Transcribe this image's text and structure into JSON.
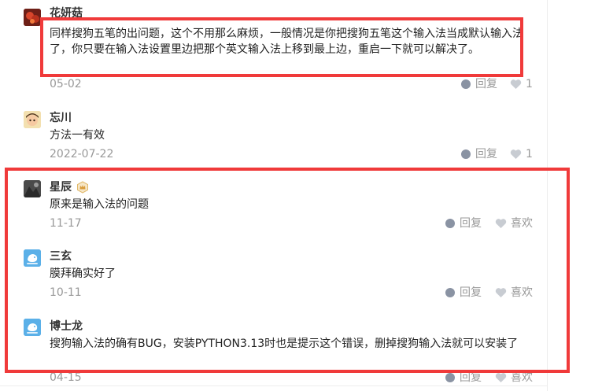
{
  "colors": {
    "highlight": "#f03a3a",
    "muted_text": "#999999",
    "icon_gray": "#8a93a3",
    "heart_gray": "#c8ccd2"
  },
  "comments": [
    {
      "username": "花妍菇",
      "content": "同样搜狗五笔的出问题，这个不用那么麻烦，一般情况是你把搜狗五笔这个输入法当成默认输入法了，你只要在输入法设置里边把那个英文输入法上移到最上边，重启一下就可以解决了。",
      "date": "05-02",
      "reply_label": "回复",
      "like_label": "1",
      "avatar_icon": "avatar-icon"
    },
    {
      "username": "忘川",
      "content": "方法一有效",
      "date": "2022-07-22",
      "reply_label": "回复",
      "like_label": "1",
      "avatar_icon": "avatar-icon"
    },
    {
      "username": "星辰",
      "content": "原来是输入法的问题",
      "date": "11-17",
      "reply_label": "回复",
      "like_label": "喜欢",
      "badge_icon": "crown-badge-icon",
      "avatar_icon": "avatar-icon"
    },
    {
      "username": "三玄",
      "content": "膜拜确实好了",
      "date": "10-11",
      "reply_label": "回复",
      "like_label": "喜欢",
      "avatar_icon": "default-avatar-icon"
    },
    {
      "username": "博士龙",
      "content": "搜狗输入法的确有BUG，安装PYTHON3.13时也是提示这个错误，删掉搜狗输入法就可以安装了",
      "date": "04-15",
      "reply_label": "回复",
      "like_label": "喜欢",
      "avatar_icon": "default-avatar-icon"
    }
  ]
}
